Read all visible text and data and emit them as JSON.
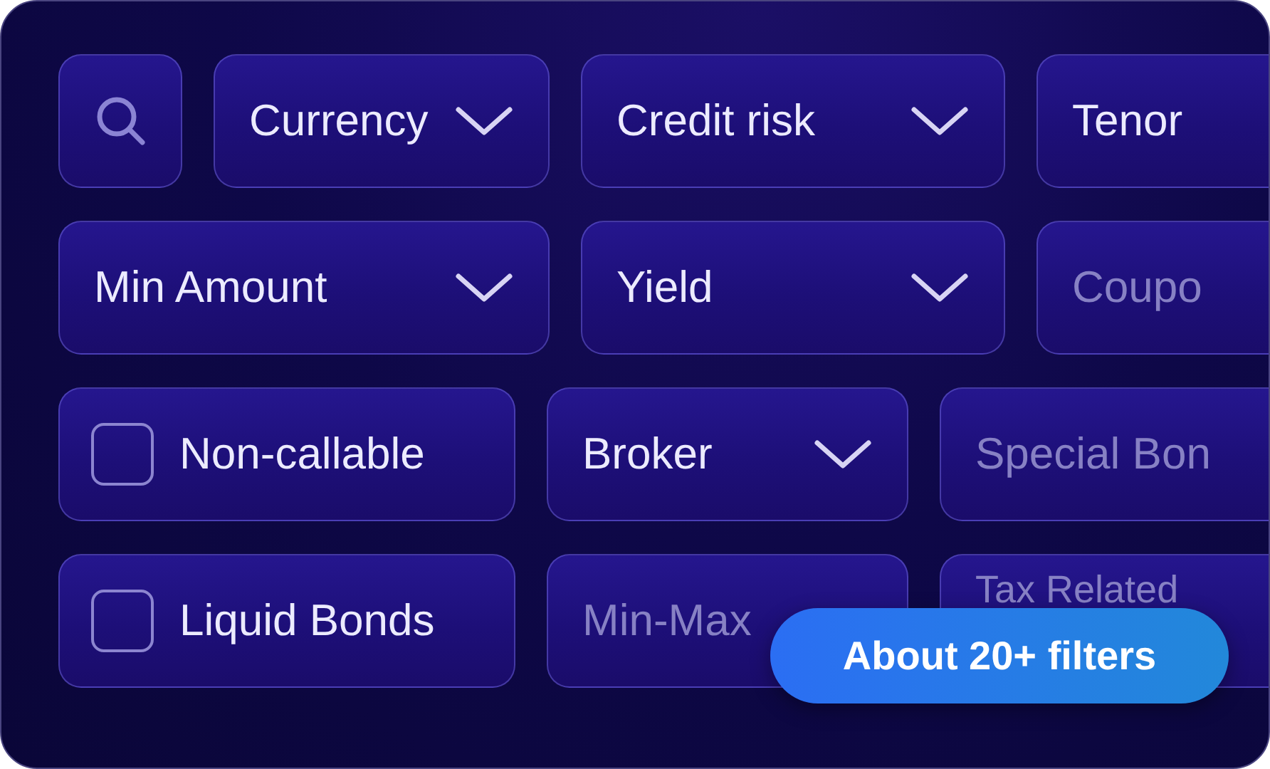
{
  "filter_rows": [
    {
      "items": [
        {
          "kind": "search"
        },
        {
          "kind": "dropdown",
          "label": "Currency"
        },
        {
          "kind": "dropdown",
          "label": "Credit risk"
        },
        {
          "kind": "text",
          "label": "Tenor"
        }
      ]
    },
    {
      "items": [
        {
          "kind": "dropdown",
          "label": "Min Amount"
        },
        {
          "kind": "dropdown",
          "label": "Yield"
        },
        {
          "kind": "field",
          "placeholder": "Coupo"
        }
      ]
    },
    {
      "items": [
        {
          "kind": "checkbox",
          "label": "Non-callable",
          "checked": false
        },
        {
          "kind": "dropdown",
          "label": "Broker"
        },
        {
          "kind": "field",
          "placeholder": "Special Bon"
        }
      ]
    },
    {
      "items": [
        {
          "kind": "checkbox",
          "label": "Liquid Bonds",
          "checked": false
        },
        {
          "kind": "field",
          "placeholder": "Min-Max"
        },
        {
          "kind": "field",
          "placeholder": "Tax Related"
        }
      ]
    }
  ],
  "badge": "About 20+ filters"
}
